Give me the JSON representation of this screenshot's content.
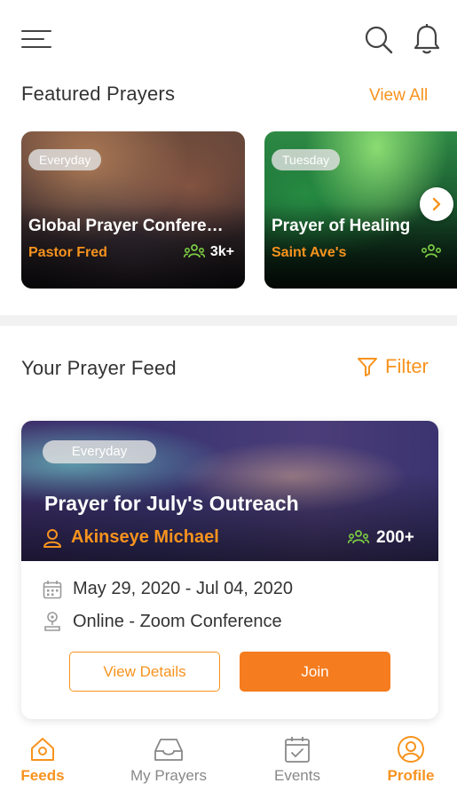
{
  "colors": {
    "accent": "#f7931e",
    "join_button": "#f57c1f",
    "text": "#333333"
  },
  "header": {
    "menu_icon": "hamburger-menu-icon",
    "search_icon": "search-icon",
    "notification_icon": "bell-icon"
  },
  "featured": {
    "title": "Featured Prayers",
    "view_all": "View All",
    "cards": [
      {
        "tag": "Everyday",
        "title": "Global Prayer Confere…",
        "host": "Pastor Fred",
        "count": "3k+"
      },
      {
        "tag": "Tuesday",
        "title": "Prayer of Healing",
        "host": "Saint Ave's",
        "count": ""
      }
    ]
  },
  "feed": {
    "title": "Your Prayer Feed",
    "filter": "Filter",
    "card": {
      "tag": "Everyday",
      "title": "Prayer for July's Outreach",
      "host": "Akinseye Michael",
      "count": "200+",
      "date": "May 29, 2020 - Jul 04, 2020",
      "location": "Online - Zoom Conference",
      "details_button": "View Details",
      "join_button": "Join"
    }
  },
  "nav": {
    "active": "Feeds",
    "items": [
      {
        "label": "Feeds",
        "icon": "home-icon"
      },
      {
        "label": "My Prayers",
        "icon": "inbox-icon"
      },
      {
        "label": "Events",
        "icon": "calendar-icon"
      },
      {
        "label": "Profile",
        "icon": "user-icon"
      }
    ]
  }
}
